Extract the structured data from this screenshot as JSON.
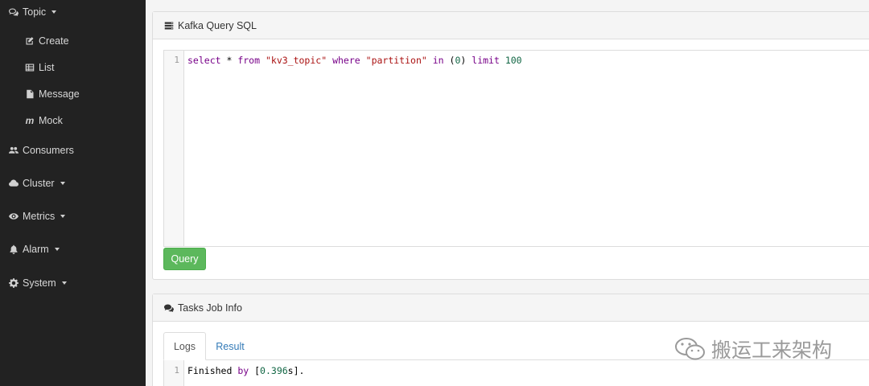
{
  "sidebar": {
    "topic": "Topic",
    "create": "Create",
    "list": "List",
    "message": "Message",
    "mock": "Mock",
    "consumers": "Consumers",
    "cluster": "Cluster",
    "metrics": "Metrics",
    "alarm": "Alarm",
    "system": "System"
  },
  "query_panel": {
    "title": "Kafka Query SQL",
    "line_number": "1",
    "sql": {
      "t1": "select",
      "t2": " * ",
      "t3": "from",
      "t4": " ",
      "t5": "\"kv3_topic\"",
      "t6": " ",
      "t7": "where",
      "t8": " ",
      "t9": "\"partition\"",
      "t10": " ",
      "t11": "in",
      "t12": " (",
      "t13": "0",
      "t14": ") ",
      "t15": "limit",
      "t16": " ",
      "t17": "100"
    },
    "query_button": "Query"
  },
  "tasks_panel": {
    "title": "Tasks Job Info",
    "tab_logs": "Logs",
    "tab_result": "Result",
    "line_number": "1",
    "log": {
      "t1": "Finished",
      "t2": " ",
      "t3": "by",
      "t4": " [",
      "t5": "0.396",
      "t6": "s]."
    }
  },
  "watermark": {
    "text": "搬运工来架构"
  },
  "colors": {
    "sidebar_bg": "#222222",
    "query_button": "#5cb85c",
    "link": "#337ab7"
  }
}
